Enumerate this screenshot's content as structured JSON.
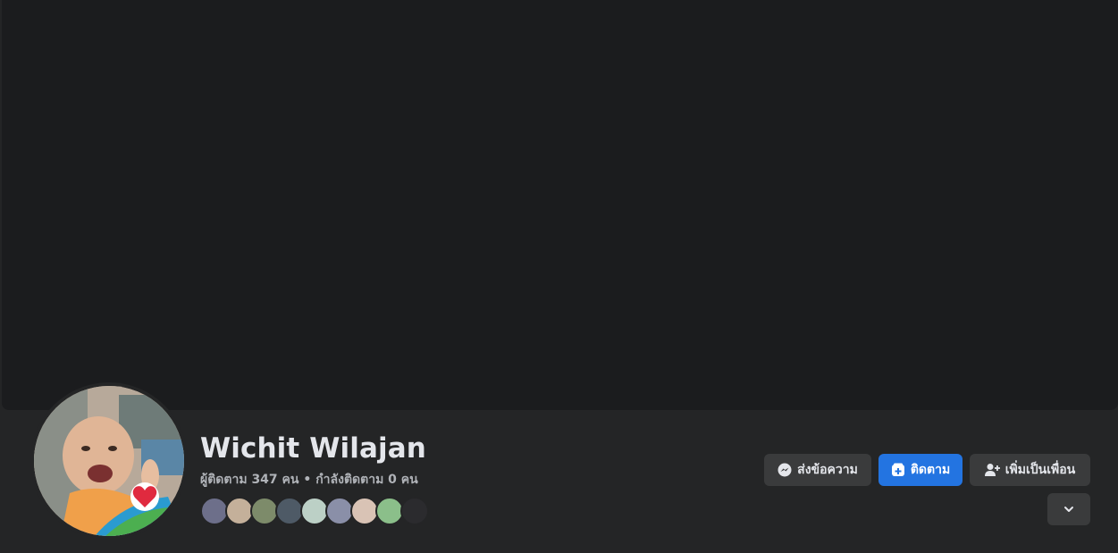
{
  "profile": {
    "name": "Wichit Wilajan",
    "followers_text": "ผู้ติดตาม 347 คน",
    "separator": "•",
    "following_text": "กำลังติดตาม 0 คน"
  },
  "actions": {
    "message_label": "ส่งข้อความ",
    "follow_label": "ติดตาม",
    "add_friend_label": "เพิ่มเป็นเพื่อน"
  },
  "icons": {
    "message": "messenger-icon",
    "follow": "follow-icon",
    "add_friend": "add-friend-icon",
    "more": "chevron-down-icon"
  },
  "colors": {
    "background": "#242526",
    "cover": "#1b1c1e",
    "primary_button": "#2374e1",
    "secondary_button": "#3a3b3c",
    "text_primary": "#e4e6eb",
    "text_secondary": "#b0b3b8"
  },
  "followers_preview_count": 8
}
